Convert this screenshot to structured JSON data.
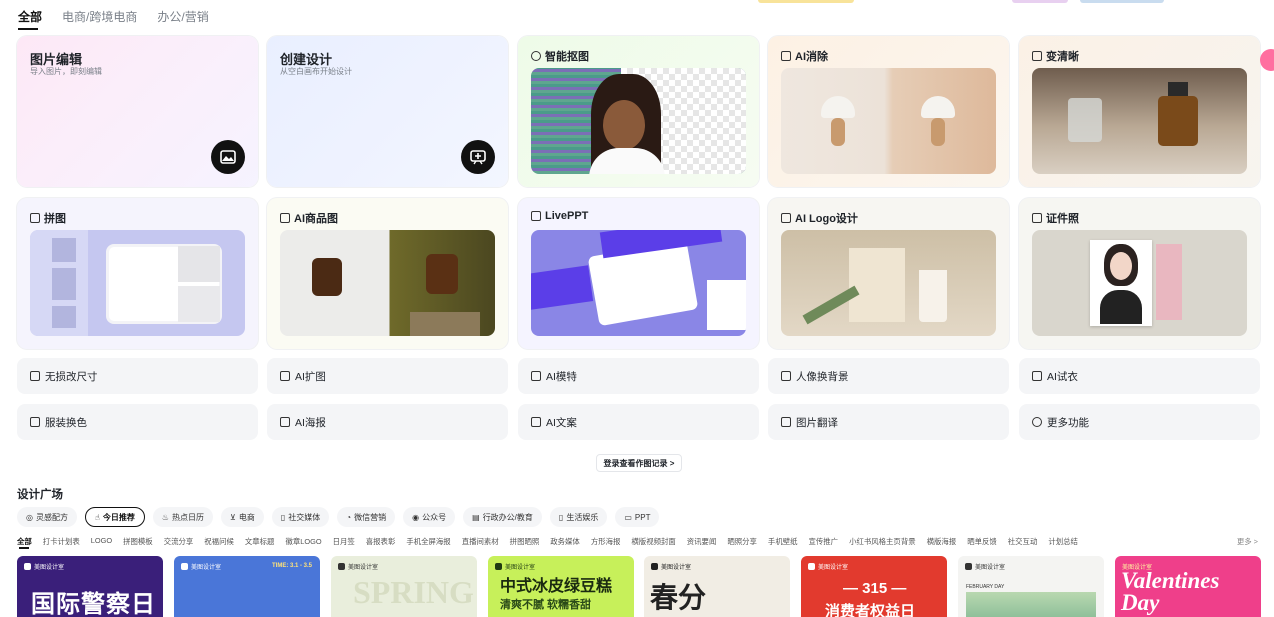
{
  "top_tabs": [
    "全部",
    "电商/跨境电商",
    "办公/营销"
  ],
  "cards_row1": [
    {
      "title": "图片编辑",
      "subtitle": "导入图片，即刻编辑"
    },
    {
      "title": "创建设计",
      "subtitle": "从空白画布开始设计"
    },
    {
      "title": "智能抠图"
    },
    {
      "title": "AI消除"
    },
    {
      "title": "变清晰"
    }
  ],
  "cards_row2": [
    {
      "title": "拼图"
    },
    {
      "title": "AI商品图"
    },
    {
      "title": "LivePPT"
    },
    {
      "title": "AI Logo设计"
    },
    {
      "title": "证件照"
    }
  ],
  "small_row1": [
    "无损改尺寸",
    "AI扩图",
    "AI模特",
    "人像换背景",
    "AI试衣"
  ],
  "small_row2": [
    "服装换色",
    "AI海报",
    "AI文案",
    "图片翻译",
    "更多功能"
  ],
  "records_button": "登录查看作图记录 >",
  "section_title": "设计广场",
  "chips": [
    "灵感配方",
    "今日推荐",
    "热点日历",
    "电商",
    "社交媒体",
    "微信营销",
    "公众号",
    "行政办公/教育",
    "生活娱乐",
    "PPT"
  ],
  "categories": [
    "全部",
    "打卡计划表",
    "LOGO",
    "拼图模板",
    "交流分享",
    "祝福问候",
    "文章标题",
    "徽章LOGO",
    "日月签",
    "喜报表彰",
    "手机全屏海报",
    "直播间素材",
    "拼图晒照",
    "政务媒体",
    "方形海报",
    "横版视频封面",
    "资讯要闻",
    "晒照分享",
    "手机壁纸",
    "宣传推广",
    "小红书风格主页背景",
    "横版海报",
    "晒单反馈",
    "社交互动",
    "计划总结"
  ],
  "more_label": "更多 >",
  "thumb_badge": "美图设计室",
  "thumbs": [
    {
      "text": "国际警察日"
    },
    {
      "text": "TIME: 3.1 - 3.5"
    },
    {
      "text": "SPRING"
    },
    {
      "text": "中式冰皮绿豆糕",
      "sub": "清爽不腻 软糯香甜"
    },
    {
      "text": "春分"
    },
    {
      "text": "— 315 —",
      "sub": "消费者权益日"
    },
    {
      "text": "FEBRUARY DAY"
    },
    {
      "text": "Valentines Day"
    }
  ],
  "colors": {
    "accent": "#111111",
    "chip_bg": "#f4f5f7"
  }
}
